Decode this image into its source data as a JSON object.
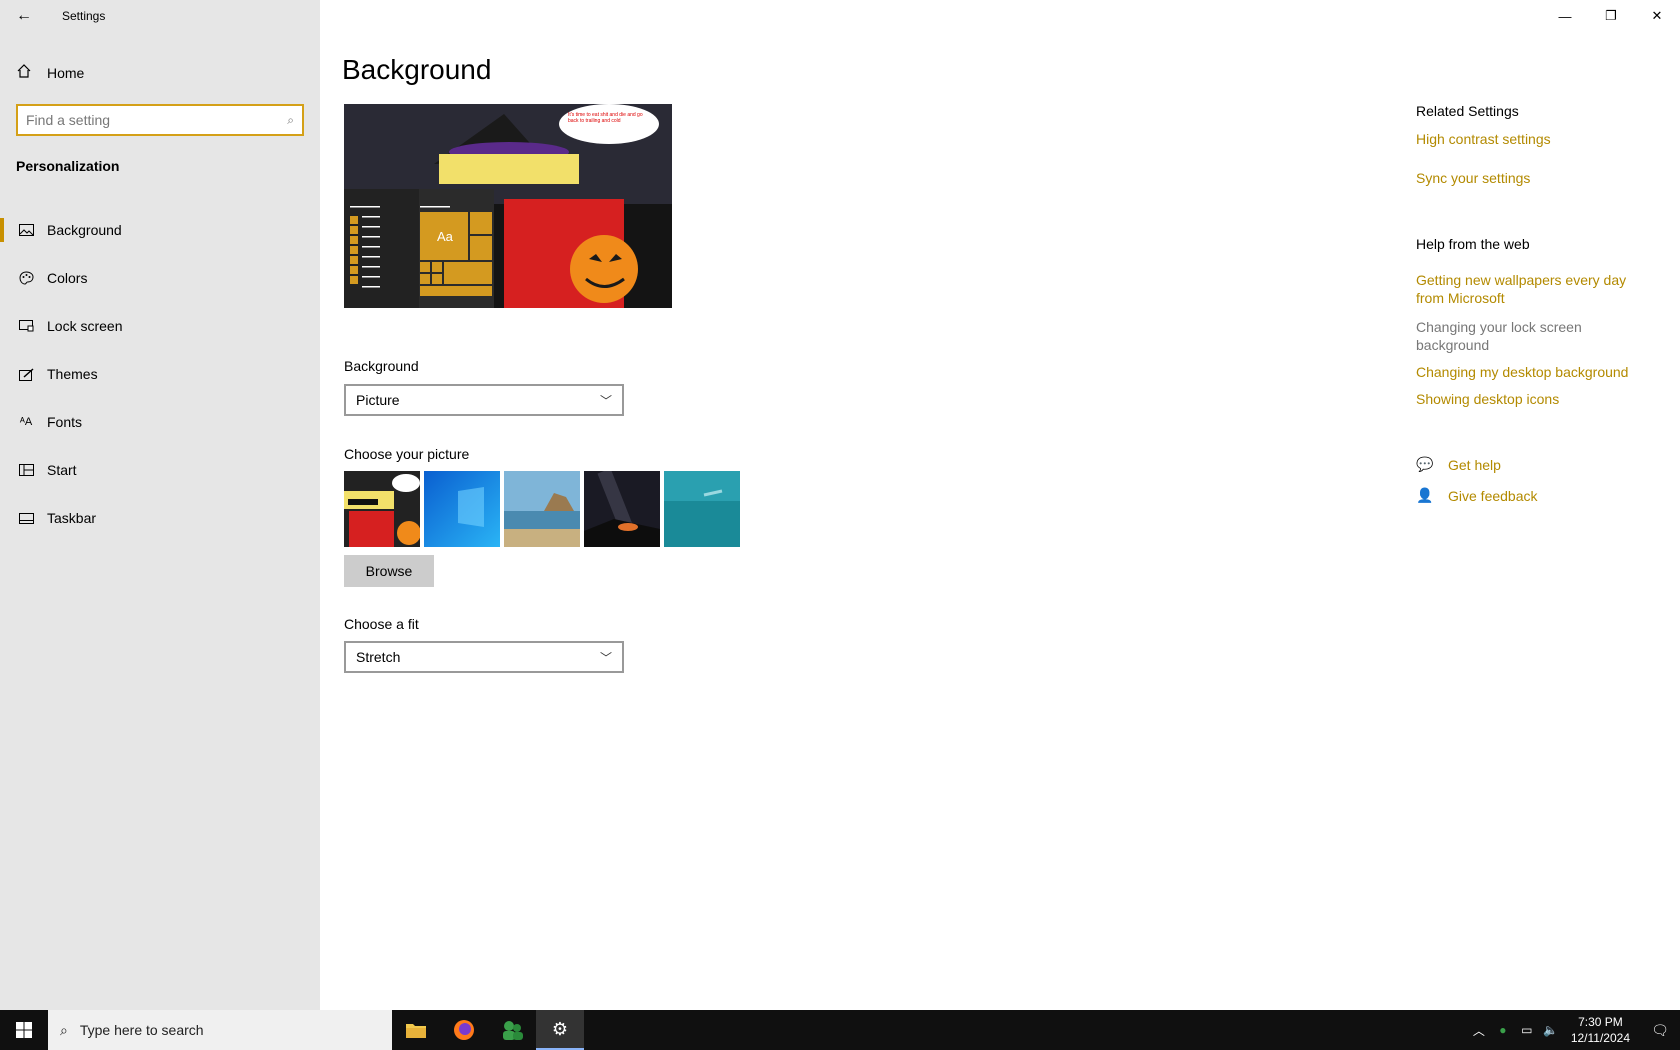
{
  "window": {
    "title": "Settings",
    "controls": {
      "minimize": "—",
      "restore": "❐",
      "close": "✕"
    }
  },
  "sidebar": {
    "home_label": "Home",
    "search_placeholder": "Find a setting",
    "section": "Personalization",
    "items": [
      {
        "label": "Background",
        "icon": "picture-icon"
      },
      {
        "label": "Colors",
        "icon": "palette-icon"
      },
      {
        "label": "Lock screen",
        "icon": "lock-screen-icon"
      },
      {
        "label": "Themes",
        "icon": "brush-icon"
      },
      {
        "label": "Fonts",
        "icon": "font-icon"
      },
      {
        "label": "Start",
        "icon": "start-icon"
      },
      {
        "label": "Taskbar",
        "icon": "taskbar-icon"
      }
    ]
  },
  "main": {
    "title": "Background",
    "preview": {
      "tile_label": "Aa",
      "speech": "It's time to eat shit and die and go back to trailing and cold"
    },
    "background_label": "Background",
    "background_value": "Picture",
    "choose_picture_label": "Choose your picture",
    "browse_label": "Browse",
    "choose_fit_label": "Choose a fit",
    "fit_value": "Stretch"
  },
  "related": {
    "heading": "Related Settings",
    "links": [
      "High contrast settings",
      "Sync your settings"
    ],
    "help_heading": "Help from the web",
    "help_links": [
      "Getting new wallpapers every day from Microsoft",
      "Changing your lock screen background",
      "Changing my desktop background",
      "Showing desktop icons"
    ],
    "get_help": "Get help",
    "give_feedback": "Give feedback"
  },
  "taskbar": {
    "search_placeholder": "Type here to search",
    "time": "7:30 PM",
    "date": "12/11/2024"
  },
  "colors": {
    "accent": "#b38a00",
    "sidebar": "#e6e6e6",
    "taskbar": "#101010"
  }
}
